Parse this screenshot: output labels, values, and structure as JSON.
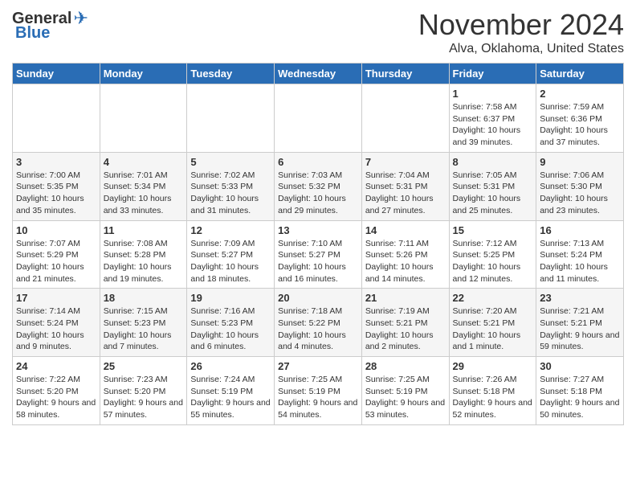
{
  "title": "November 2024",
  "location": "Alva, Oklahoma, United States",
  "logo": {
    "general": "General",
    "blue": "Blue"
  },
  "days_of_week": [
    "Sunday",
    "Monday",
    "Tuesday",
    "Wednesday",
    "Thursday",
    "Friday",
    "Saturday"
  ],
  "weeks": [
    [
      {
        "day": "",
        "info": ""
      },
      {
        "day": "",
        "info": ""
      },
      {
        "day": "",
        "info": ""
      },
      {
        "day": "",
        "info": ""
      },
      {
        "day": "",
        "info": ""
      },
      {
        "day": "1",
        "info": "Sunrise: 7:58 AM\nSunset: 6:37 PM\nDaylight: 10 hours and 39 minutes."
      },
      {
        "day": "2",
        "info": "Sunrise: 7:59 AM\nSunset: 6:36 PM\nDaylight: 10 hours and 37 minutes."
      }
    ],
    [
      {
        "day": "3",
        "info": "Sunrise: 7:00 AM\nSunset: 5:35 PM\nDaylight: 10 hours and 35 minutes."
      },
      {
        "day": "4",
        "info": "Sunrise: 7:01 AM\nSunset: 5:34 PM\nDaylight: 10 hours and 33 minutes."
      },
      {
        "day": "5",
        "info": "Sunrise: 7:02 AM\nSunset: 5:33 PM\nDaylight: 10 hours and 31 minutes."
      },
      {
        "day": "6",
        "info": "Sunrise: 7:03 AM\nSunset: 5:32 PM\nDaylight: 10 hours and 29 minutes."
      },
      {
        "day": "7",
        "info": "Sunrise: 7:04 AM\nSunset: 5:31 PM\nDaylight: 10 hours and 27 minutes."
      },
      {
        "day": "8",
        "info": "Sunrise: 7:05 AM\nSunset: 5:31 PM\nDaylight: 10 hours and 25 minutes."
      },
      {
        "day": "9",
        "info": "Sunrise: 7:06 AM\nSunset: 5:30 PM\nDaylight: 10 hours and 23 minutes."
      }
    ],
    [
      {
        "day": "10",
        "info": "Sunrise: 7:07 AM\nSunset: 5:29 PM\nDaylight: 10 hours and 21 minutes."
      },
      {
        "day": "11",
        "info": "Sunrise: 7:08 AM\nSunset: 5:28 PM\nDaylight: 10 hours and 19 minutes."
      },
      {
        "day": "12",
        "info": "Sunrise: 7:09 AM\nSunset: 5:27 PM\nDaylight: 10 hours and 18 minutes."
      },
      {
        "day": "13",
        "info": "Sunrise: 7:10 AM\nSunset: 5:27 PM\nDaylight: 10 hours and 16 minutes."
      },
      {
        "day": "14",
        "info": "Sunrise: 7:11 AM\nSunset: 5:26 PM\nDaylight: 10 hours and 14 minutes."
      },
      {
        "day": "15",
        "info": "Sunrise: 7:12 AM\nSunset: 5:25 PM\nDaylight: 10 hours and 12 minutes."
      },
      {
        "day": "16",
        "info": "Sunrise: 7:13 AM\nSunset: 5:24 PM\nDaylight: 10 hours and 11 minutes."
      }
    ],
    [
      {
        "day": "17",
        "info": "Sunrise: 7:14 AM\nSunset: 5:24 PM\nDaylight: 10 hours and 9 minutes."
      },
      {
        "day": "18",
        "info": "Sunrise: 7:15 AM\nSunset: 5:23 PM\nDaylight: 10 hours and 7 minutes."
      },
      {
        "day": "19",
        "info": "Sunrise: 7:16 AM\nSunset: 5:23 PM\nDaylight: 10 hours and 6 minutes."
      },
      {
        "day": "20",
        "info": "Sunrise: 7:18 AM\nSunset: 5:22 PM\nDaylight: 10 hours and 4 minutes."
      },
      {
        "day": "21",
        "info": "Sunrise: 7:19 AM\nSunset: 5:21 PM\nDaylight: 10 hours and 2 minutes."
      },
      {
        "day": "22",
        "info": "Sunrise: 7:20 AM\nSunset: 5:21 PM\nDaylight: 10 hours and 1 minute."
      },
      {
        "day": "23",
        "info": "Sunrise: 7:21 AM\nSunset: 5:21 PM\nDaylight: 9 hours and 59 minutes."
      }
    ],
    [
      {
        "day": "24",
        "info": "Sunrise: 7:22 AM\nSunset: 5:20 PM\nDaylight: 9 hours and 58 minutes."
      },
      {
        "day": "25",
        "info": "Sunrise: 7:23 AM\nSunset: 5:20 PM\nDaylight: 9 hours and 57 minutes."
      },
      {
        "day": "26",
        "info": "Sunrise: 7:24 AM\nSunset: 5:19 PM\nDaylight: 9 hours and 55 minutes."
      },
      {
        "day": "27",
        "info": "Sunrise: 7:25 AM\nSunset: 5:19 PM\nDaylight: 9 hours and 54 minutes."
      },
      {
        "day": "28",
        "info": "Sunrise: 7:25 AM\nSunset: 5:19 PM\nDaylight: 9 hours and 53 minutes."
      },
      {
        "day": "29",
        "info": "Sunrise: 7:26 AM\nSunset: 5:18 PM\nDaylight: 9 hours and 52 minutes."
      },
      {
        "day": "30",
        "info": "Sunrise: 7:27 AM\nSunset: 5:18 PM\nDaylight: 9 hours and 50 minutes."
      }
    ]
  ]
}
